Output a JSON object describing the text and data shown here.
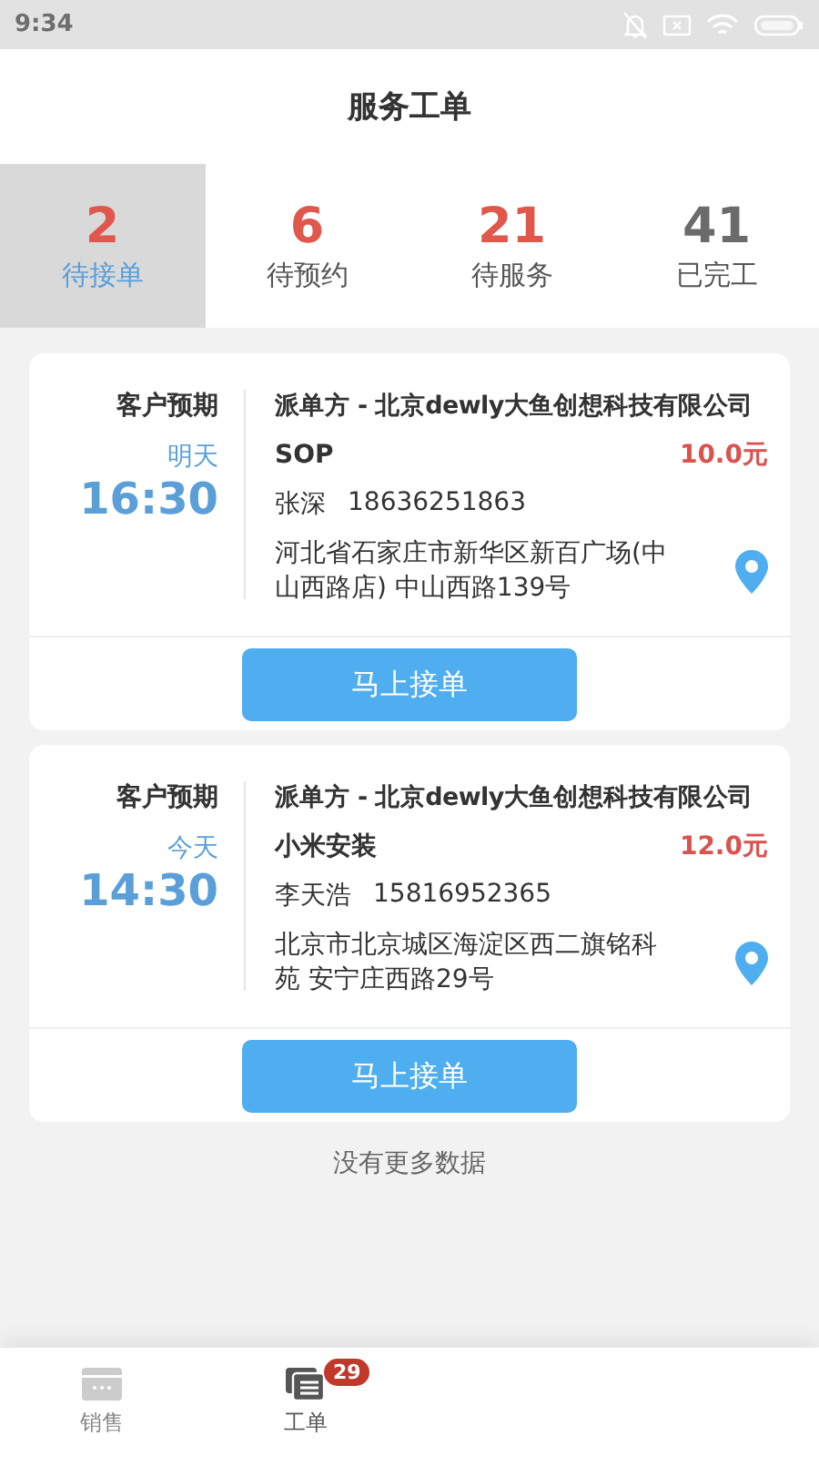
{
  "status_bar": {
    "time": "9:34"
  },
  "header": {
    "title": "服务工单"
  },
  "tabs": [
    {
      "count": "2",
      "label": "待接单",
      "color": "#e0574c",
      "selected": true
    },
    {
      "count": "6",
      "label": "待预约",
      "color": "#e0574c",
      "selected": false
    },
    {
      "count": "21",
      "label": "待服务",
      "color": "#e0574c",
      "selected": false
    },
    {
      "count": "41",
      "label": "已完工",
      "color": "#6b6b6b",
      "selected": false
    }
  ],
  "orders": [
    {
      "expect_label": "客户预期",
      "day": "明天",
      "time": "16:30",
      "dispatcher": "派单方 - 北京dewly大鱼创想科技有限公司",
      "service": "SOP",
      "price": "10.0元",
      "contact_name": "张深",
      "phone": "18636251863",
      "address": "河北省石家庄市新华区新百广场(中山西路店) 中山西路139号",
      "button": "马上接单"
    },
    {
      "expect_label": "客户预期",
      "day": "今天",
      "time": "14:30",
      "dispatcher": "派单方 - 北京dewly大鱼创想科技有限公司",
      "service": "小米安装",
      "price": "12.0元",
      "contact_name": "李天浩",
      "phone": "15816952365",
      "address": "北京市北京城区海淀区西二旗铭科苑 安宁庄西路29号",
      "button": "马上接单"
    }
  ],
  "footer_note": "没有更多数据",
  "bottom_nav": [
    {
      "label": "销售",
      "selected": false
    },
    {
      "label": "工单",
      "badge": "29",
      "selected": true
    }
  ]
}
